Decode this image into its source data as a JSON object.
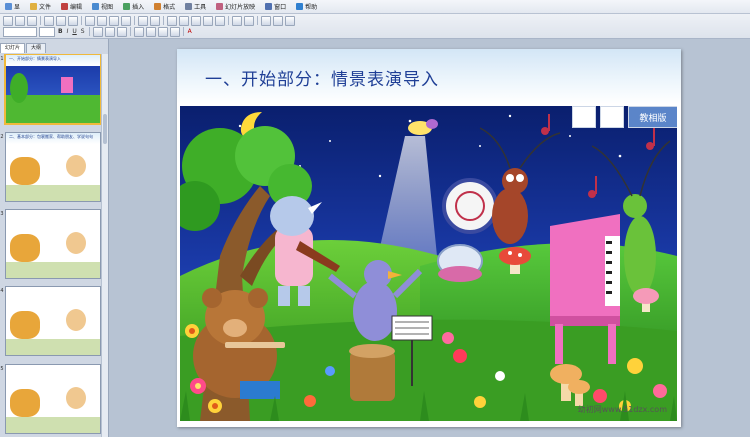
{
  "menubar": {
    "items": [
      {
        "label": "显",
        "icon_color": "#5a8fd6"
      },
      {
        "label": "文件",
        "icon_color": "#e0b040"
      },
      {
        "label": "编辑",
        "icon_color": "#c04040"
      },
      {
        "label": "视图",
        "icon_color": "#4a8ad0"
      },
      {
        "label": "插入",
        "icon_color": "#4aa060"
      },
      {
        "label": "格式",
        "icon_color": "#d08030"
      },
      {
        "label": "工具",
        "icon_color": "#7080a0"
      },
      {
        "label": "幻灯片放映",
        "icon_color": "#c06080"
      },
      {
        "label": "窗口",
        "icon_color": "#5070b0"
      },
      {
        "label": "帮助",
        "icon_color": "#3080d0"
      }
    ]
  },
  "toolbar": {
    "row2_labels": [
      "B",
      "I",
      "U",
      "S",
      "A"
    ]
  },
  "left_pane": {
    "tabs": [
      "幻灯片",
      "大纲"
    ],
    "slides": [
      {
        "number": "1",
        "title": "一、开始部分：情景表演导入",
        "selected": true
      },
      {
        "number": "2",
        "title": "二、基本部分：包裹搬家、帮助朋友、学说句句",
        "selected": false
      },
      {
        "number": "3",
        "title": "",
        "selected": false
      },
      {
        "number": "4",
        "title": "",
        "selected": false
      },
      {
        "number": "5",
        "title": "",
        "selected": false
      }
    ]
  },
  "slide": {
    "title": "一、开始部分：情景表演导入",
    "header_button_label": "教相版",
    "watermark": "幼初网www.51dzx.com"
  },
  "colors": {
    "title": "#1f3f96",
    "accent_blue": "#5b85c9",
    "selection": "#f0b93b"
  }
}
